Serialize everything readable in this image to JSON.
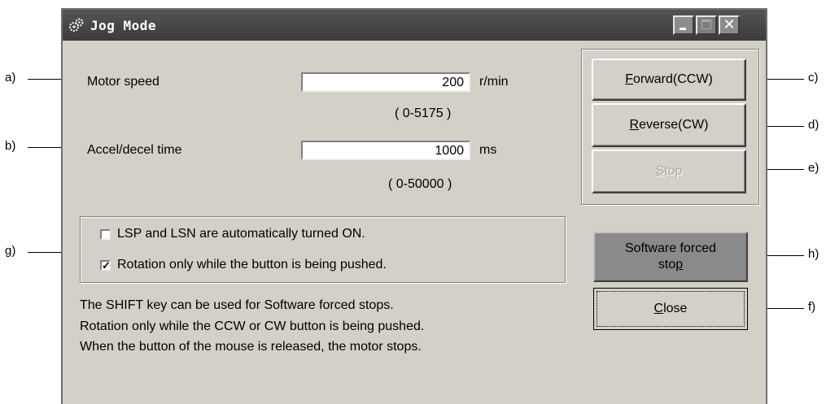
{
  "window": {
    "title": "Jog Mode"
  },
  "callouts": {
    "a": "a)",
    "b": "b)",
    "c": "c)",
    "d": "d)",
    "e": "e)",
    "f": "f)",
    "g": "g)",
    "h": "h)"
  },
  "motor_speed": {
    "label": "Motor speed",
    "value": "200",
    "unit": "r/min",
    "range": "( 0-5175 )"
  },
  "accel_decel": {
    "label": "Accel/decel time",
    "value": "1000",
    "unit": "ms",
    "range": "( 0-50000 )"
  },
  "options": {
    "lsp_lsn": {
      "label": "LSP and LSN are automatically turned ON.",
      "checked": false
    },
    "rotation_hold": {
      "label": "Rotation only while the button is being pushed.",
      "checked": true
    }
  },
  "notes": [
    "The SHIFT key can be used for Software forced stops.",
    "Rotation only while the CCW or CW button is being pushed.",
    "When the button of the mouse is released, the motor stops."
  ],
  "buttons": {
    "forward": {
      "mnemonic": "F",
      "rest": "orward(CCW)"
    },
    "reverse": {
      "mnemonic": "R",
      "rest": "everse(CW)"
    },
    "stop": {
      "mnemonic": "S",
      "rest": "top"
    },
    "software_forced_stop": {
      "line1": "Software forced",
      "line2_pre": "sto",
      "line2_mnemonic": "p"
    },
    "close": {
      "mnemonic": "C",
      "rest": "lose"
    }
  }
}
